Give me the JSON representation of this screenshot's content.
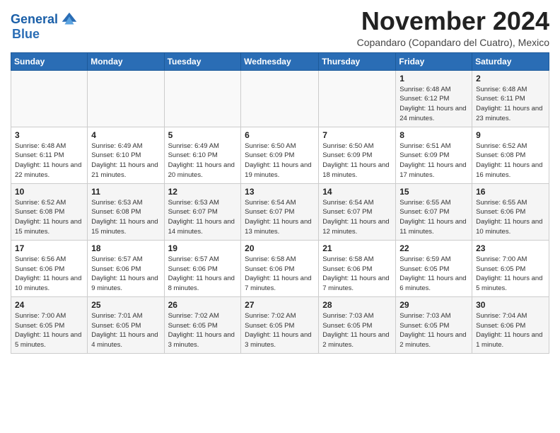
{
  "logo": {
    "line1": "General",
    "line2": "Blue"
  },
  "title": "November 2024",
  "subtitle": "Copandaro (Copandaro del Cuatro), Mexico",
  "days_header": [
    "Sunday",
    "Monday",
    "Tuesday",
    "Wednesday",
    "Thursday",
    "Friday",
    "Saturday"
  ],
  "weeks": [
    [
      {
        "day": "",
        "info": ""
      },
      {
        "day": "",
        "info": ""
      },
      {
        "day": "",
        "info": ""
      },
      {
        "day": "",
        "info": ""
      },
      {
        "day": "",
        "info": ""
      },
      {
        "day": "1",
        "info": "Sunrise: 6:48 AM\nSunset: 6:12 PM\nDaylight: 11 hours and 24 minutes."
      },
      {
        "day": "2",
        "info": "Sunrise: 6:48 AM\nSunset: 6:11 PM\nDaylight: 11 hours and 23 minutes."
      }
    ],
    [
      {
        "day": "3",
        "info": "Sunrise: 6:48 AM\nSunset: 6:11 PM\nDaylight: 11 hours and 22 minutes."
      },
      {
        "day": "4",
        "info": "Sunrise: 6:49 AM\nSunset: 6:10 PM\nDaylight: 11 hours and 21 minutes."
      },
      {
        "day": "5",
        "info": "Sunrise: 6:49 AM\nSunset: 6:10 PM\nDaylight: 11 hours and 20 minutes."
      },
      {
        "day": "6",
        "info": "Sunrise: 6:50 AM\nSunset: 6:09 PM\nDaylight: 11 hours and 19 minutes."
      },
      {
        "day": "7",
        "info": "Sunrise: 6:50 AM\nSunset: 6:09 PM\nDaylight: 11 hours and 18 minutes."
      },
      {
        "day": "8",
        "info": "Sunrise: 6:51 AM\nSunset: 6:09 PM\nDaylight: 11 hours and 17 minutes."
      },
      {
        "day": "9",
        "info": "Sunrise: 6:52 AM\nSunset: 6:08 PM\nDaylight: 11 hours and 16 minutes."
      }
    ],
    [
      {
        "day": "10",
        "info": "Sunrise: 6:52 AM\nSunset: 6:08 PM\nDaylight: 11 hours and 15 minutes."
      },
      {
        "day": "11",
        "info": "Sunrise: 6:53 AM\nSunset: 6:08 PM\nDaylight: 11 hours and 15 minutes."
      },
      {
        "day": "12",
        "info": "Sunrise: 6:53 AM\nSunset: 6:07 PM\nDaylight: 11 hours and 14 minutes."
      },
      {
        "day": "13",
        "info": "Sunrise: 6:54 AM\nSunset: 6:07 PM\nDaylight: 11 hours and 13 minutes."
      },
      {
        "day": "14",
        "info": "Sunrise: 6:54 AM\nSunset: 6:07 PM\nDaylight: 11 hours and 12 minutes."
      },
      {
        "day": "15",
        "info": "Sunrise: 6:55 AM\nSunset: 6:07 PM\nDaylight: 11 hours and 11 minutes."
      },
      {
        "day": "16",
        "info": "Sunrise: 6:55 AM\nSunset: 6:06 PM\nDaylight: 11 hours and 10 minutes."
      }
    ],
    [
      {
        "day": "17",
        "info": "Sunrise: 6:56 AM\nSunset: 6:06 PM\nDaylight: 11 hours and 10 minutes."
      },
      {
        "day": "18",
        "info": "Sunrise: 6:57 AM\nSunset: 6:06 PM\nDaylight: 11 hours and 9 minutes."
      },
      {
        "day": "19",
        "info": "Sunrise: 6:57 AM\nSunset: 6:06 PM\nDaylight: 11 hours and 8 minutes."
      },
      {
        "day": "20",
        "info": "Sunrise: 6:58 AM\nSunset: 6:06 PM\nDaylight: 11 hours and 7 minutes."
      },
      {
        "day": "21",
        "info": "Sunrise: 6:58 AM\nSunset: 6:06 PM\nDaylight: 11 hours and 7 minutes."
      },
      {
        "day": "22",
        "info": "Sunrise: 6:59 AM\nSunset: 6:05 PM\nDaylight: 11 hours and 6 minutes."
      },
      {
        "day": "23",
        "info": "Sunrise: 7:00 AM\nSunset: 6:05 PM\nDaylight: 11 hours and 5 minutes."
      }
    ],
    [
      {
        "day": "24",
        "info": "Sunrise: 7:00 AM\nSunset: 6:05 PM\nDaylight: 11 hours and 5 minutes."
      },
      {
        "day": "25",
        "info": "Sunrise: 7:01 AM\nSunset: 6:05 PM\nDaylight: 11 hours and 4 minutes."
      },
      {
        "day": "26",
        "info": "Sunrise: 7:02 AM\nSunset: 6:05 PM\nDaylight: 11 hours and 3 minutes."
      },
      {
        "day": "27",
        "info": "Sunrise: 7:02 AM\nSunset: 6:05 PM\nDaylight: 11 hours and 3 minutes."
      },
      {
        "day": "28",
        "info": "Sunrise: 7:03 AM\nSunset: 6:05 PM\nDaylight: 11 hours and 2 minutes."
      },
      {
        "day": "29",
        "info": "Sunrise: 7:03 AM\nSunset: 6:05 PM\nDaylight: 11 hours and 2 minutes."
      },
      {
        "day": "30",
        "info": "Sunrise: 7:04 AM\nSunset: 6:06 PM\nDaylight: 11 hours and 1 minute."
      }
    ]
  ]
}
